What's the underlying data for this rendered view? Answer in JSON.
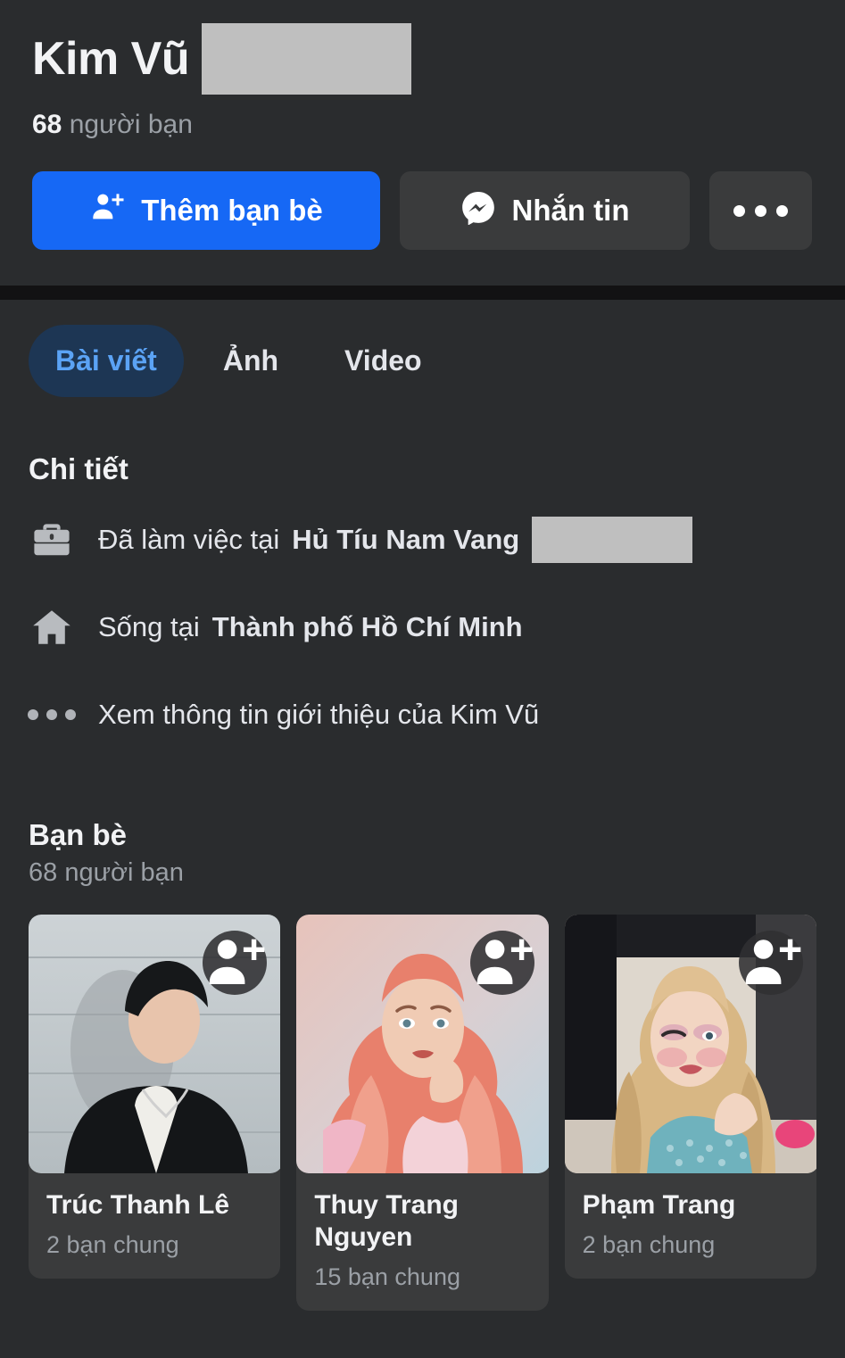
{
  "profile": {
    "name": "Kim Vũ",
    "name_redacted": true,
    "friend_count_value": "68",
    "friend_count_label": "người bạn"
  },
  "actions": {
    "add_friend_label": "Thêm bạn bè",
    "add_friend_icon": "person-plus-icon",
    "message_label": "Nhắn tin",
    "message_icon": "messenger-icon",
    "more_icon": "ellipsis-icon"
  },
  "tabs": [
    {
      "label": "Bài viết",
      "active": true
    },
    {
      "label": "Ảnh",
      "active": false
    },
    {
      "label": "Video",
      "active": false
    }
  ],
  "details": {
    "title": "Chi tiết",
    "rows": [
      {
        "icon": "briefcase-icon",
        "prefix": "Đã làm việc tại ",
        "emphasis": "Hủ Tíu Nam Vang",
        "redacted": true
      },
      {
        "icon": "home-icon",
        "prefix": "Sống tại ",
        "emphasis": "Thành phố Hồ Chí Minh",
        "redacted": false
      },
      {
        "icon": "ellipsis-icon",
        "prefix": "Xem thông tin giới thiệu của Kim Vũ",
        "emphasis": "",
        "redacted": false
      }
    ]
  },
  "friends": {
    "title": "Bạn bè",
    "subtitle": "68 người bạn",
    "add_badge_icon": "person-plus-icon",
    "cards": [
      {
        "name": "Trúc Thanh Lê",
        "mutual": "2 bạn chung"
      },
      {
        "name": "Thuy Trang Nguyen",
        "mutual": "15 bạn chung"
      },
      {
        "name": "Phạm Trang",
        "mutual": "2 bạn chung"
      }
    ]
  },
  "colors": {
    "background": "#2a2c2e",
    "card": "#3a3b3c",
    "primary_button": "#1668f5",
    "active_tab_bg": "#1d3654",
    "active_tab_text": "#5ba3f5",
    "text_primary": "#f2f3f5",
    "text_secondary": "#9ba0a6",
    "redaction": "#bfbfbf"
  }
}
